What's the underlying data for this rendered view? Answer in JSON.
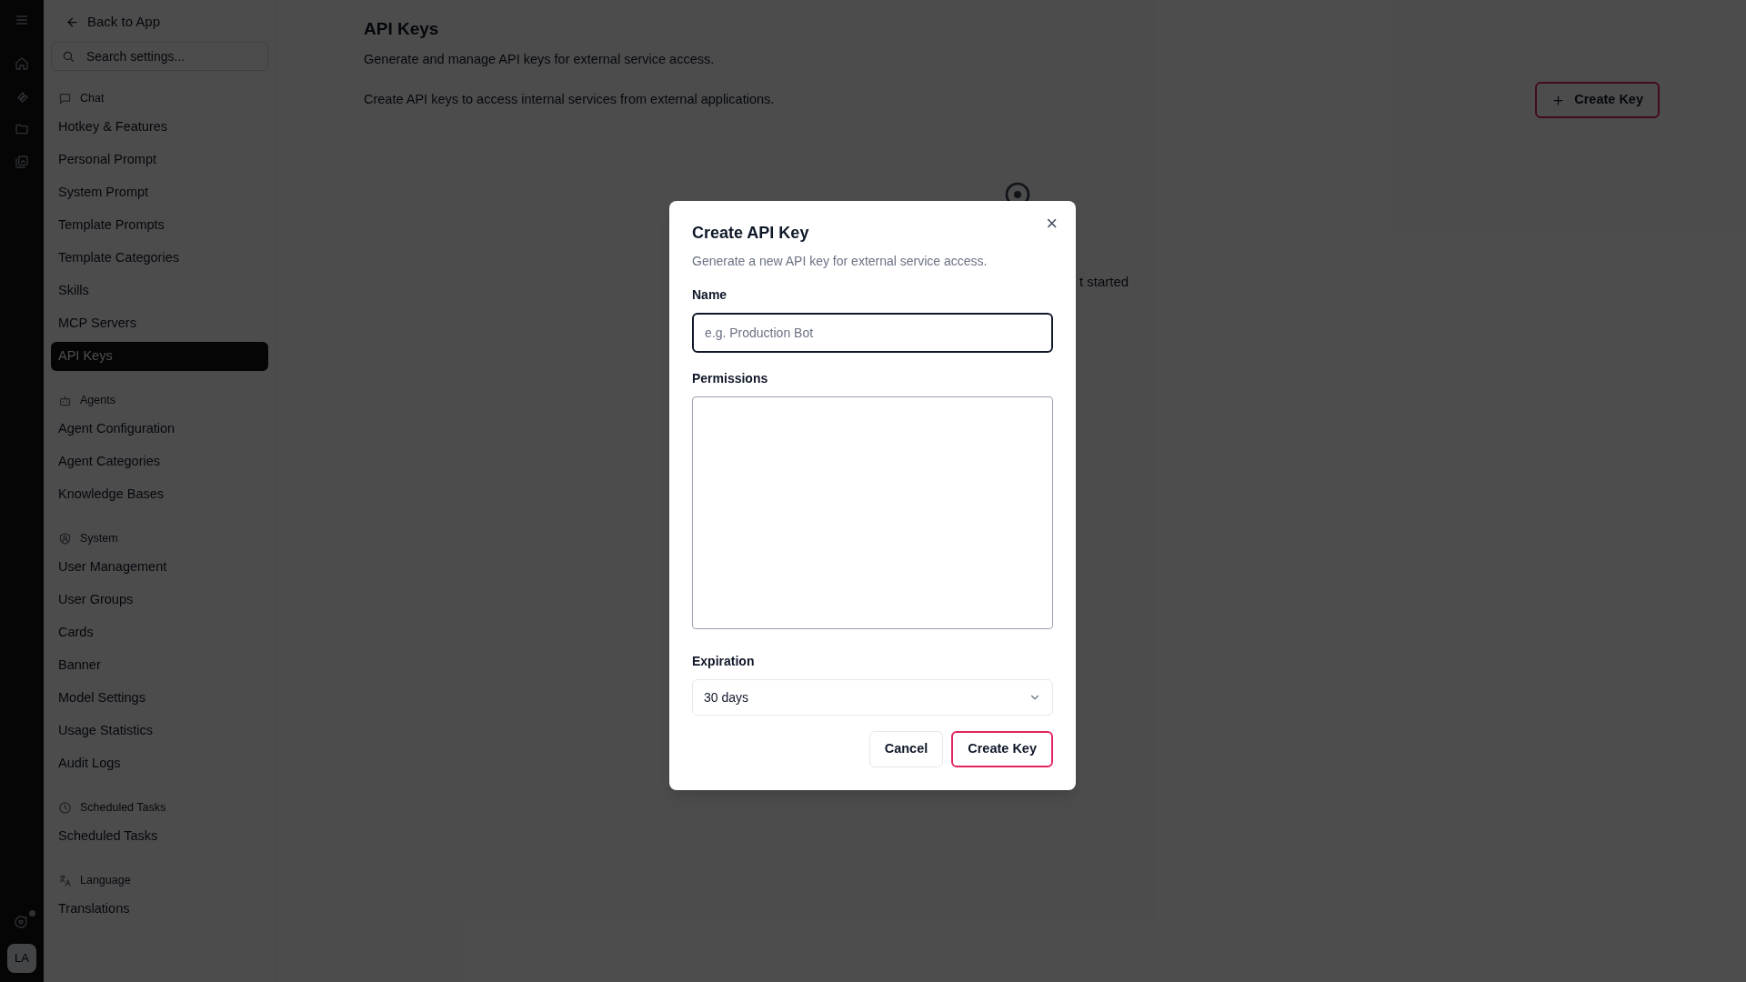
{
  "rail": {
    "avatar": "LA"
  },
  "sidebar": {
    "back_link": "Back to App",
    "search": {
      "placeholder": "Search settings..."
    },
    "sections": [
      {
        "title": "Chat",
        "items": [
          {
            "label": "Hotkey & Features",
            "selected": false
          },
          {
            "label": "Personal Prompt",
            "selected": false
          },
          {
            "label": "System Prompt",
            "selected": false
          },
          {
            "label": "Template Prompts",
            "selected": false
          },
          {
            "label": "Template Categories",
            "selected": false
          },
          {
            "label": "Skills",
            "selected": false
          },
          {
            "label": "MCP Servers",
            "selected": false
          },
          {
            "label": "API Keys",
            "selected": true
          }
        ]
      },
      {
        "title": "Agents",
        "items": [
          {
            "label": "Agent Configuration",
            "selected": false
          },
          {
            "label": "Agent Categories",
            "selected": false
          },
          {
            "label": "Knowledge Bases",
            "selected": false
          }
        ]
      },
      {
        "title": "System",
        "items": [
          {
            "label": "User Management",
            "selected": false
          },
          {
            "label": "User Groups",
            "selected": false
          },
          {
            "label": "Cards",
            "selected": false
          },
          {
            "label": "Banner",
            "selected": false
          },
          {
            "label": "Model Settings",
            "selected": false
          },
          {
            "label": "Usage Statistics",
            "selected": false
          },
          {
            "label": "Audit Logs",
            "selected": false
          }
        ]
      },
      {
        "title": "Scheduled Tasks",
        "items": [
          {
            "label": "Scheduled Tasks",
            "selected": false
          }
        ]
      },
      {
        "title": "Language",
        "items": [
          {
            "label": "Translations",
            "selected": false
          }
        ]
      }
    ]
  },
  "page": {
    "title": "API Keys",
    "subtitle": "Generate and manage API keys for external service access.",
    "description": "Create API keys to access internal services from external applications.",
    "create_button": "Create Key",
    "empty_state_fragment": "t started"
  },
  "dialog": {
    "title": "Create API Key",
    "description": "Generate a new API key for external service access.",
    "close": "×",
    "name_field": {
      "label": "Name",
      "placeholder": "e.g. Production Bot",
      "focused": true
    },
    "permissions_field": {
      "label": "Permissions"
    },
    "expiration_field": {
      "label": "Expiration",
      "value": "30 days"
    },
    "buttons": [
      {
        "kind": "secondary",
        "label": "Cancel"
      },
      {
        "kind": "primary",
        "label": "Create Key"
      }
    ]
  }
}
